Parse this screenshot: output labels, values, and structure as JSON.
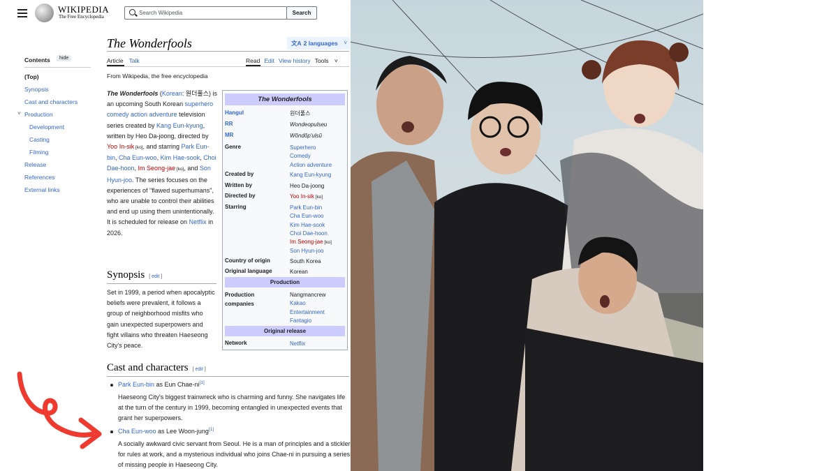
{
  "header": {
    "logo_wordmark": "WIKIPEDIA",
    "logo_tagline": "The Free Encyclopedia",
    "search_placeholder": "Search Wikipedia",
    "search_button": "Search"
  },
  "article": {
    "title": "The Wonderfools",
    "languages": "2 languages",
    "tabs_left": [
      "Article",
      "Talk"
    ],
    "tabs_right": [
      "Read",
      "Edit",
      "View history",
      "Tools"
    ],
    "from": "From Wikipedia, the free encyclopedia"
  },
  "toc": {
    "heading": "Contents",
    "hide": "hide",
    "items": [
      "(Top)",
      "Synopsis",
      "Cast and characters",
      "Production",
      "Development",
      "Casting",
      "Filming",
      "Release",
      "References",
      "External links"
    ]
  },
  "lead": {
    "t1": "The Wonderfools",
    "t2": " (",
    "t3": "Korean",
    "t4": ": 원더풀스) is an upcoming South Korean ",
    "t5": "superhero comedy action adventure",
    "t6": " television series created by ",
    "t7": "Kang Eun-kyung",
    "t8": ", written by Heo Da-joong, directed by ",
    "t9": "Yoo In-sik",
    "t10": " [ko]",
    "t11": ", and starring ",
    "t12": "Park Eun-bin",
    "t13": ", ",
    "t14": "Cha Eun-woo",
    "t15": ", ",
    "t16": "Kim Hae-sook",
    "t17": ", ",
    "t18": "Choi Dae-hoon",
    "t19": ", ",
    "t20": "Im Seong-jae",
    "t21": " [ko]",
    "t22": ", and ",
    "t23": "Son Hyun-joo",
    "t24": ". The series focuses on the experiences of \"flawed superhumans\", who are unable to control their abilities and end up using them unintentionally. It is scheduled for release on ",
    "t25": "Netflix",
    "t26": " in 2026."
  },
  "infobox": {
    "title": "The Wonderfools",
    "hangul_label": "Hangul",
    "hangul": "원더풀스",
    "rr_label": "RR",
    "rr": "Wondeopulseu",
    "mr_label": "MR",
    "mr": "Wŏndŏp'ulsŭ",
    "genre_label": "Genre",
    "genre": [
      "Superhero",
      "Comedy",
      "Action adventure"
    ],
    "created_label": "Created by",
    "created": "Kang Eun-kyung",
    "written_label": "Written by",
    "written": "Heo Da-joong",
    "directed_label": "Directed by",
    "directed": "Yoo In-sik",
    "directed_ko": " [ko]",
    "starring_label": "Starring",
    "starring": [
      "Park Eun-bin",
      "Cha Eun-woo",
      "Kim Hae-sook",
      "Choi Dae-hoon",
      "Im Seong-jae",
      "Son Hyun-joo"
    ],
    "starring_ko": " [ko]",
    "country_label": "Country of origin",
    "country": "South Korea",
    "language_label": "Original language",
    "language": "Korean",
    "production_band": "Production",
    "companies_label": "Production companies",
    "companies": [
      "Nangmancrew",
      "Kakao",
      "Entertainment",
      "Fantagio"
    ],
    "release_band": "Original release",
    "network_label": "Network",
    "network": "Netflix"
  },
  "synopsis": {
    "heading": "Synopsis",
    "edit": "edit",
    "text": "Set in 1999, a period when apocalyptic beliefs were prevalent, it follows a group of neighborhood misfits who gain unexpected superpowers and fight villains who threaten Haeseong City's peace."
  },
  "cast": {
    "heading": "Cast and characters",
    "edit": "edit",
    "items": [
      {
        "name": "Park Eun-bin",
        "role": " as Eun Chae-ni",
        "ref": "[1]",
        "desc": "Haeseong City's biggest trainwreck who is charming and funny. She navigates life at the turn of the century in 1999, becoming entangled in unexpected events that grant her superpowers."
      },
      {
        "name": "Cha Eun-woo",
        "role": " as Lee Woon-jung",
        "ref": "[1]",
        "desc": "A socially awkward civic servant from Seoul. He is a man of principles and a stickler for rules at work, and a mysterious individual who joins Chae-ni in pursuing a series of missing people in Haeseong City."
      }
    ]
  },
  "colors": {
    "link": "#3366cc",
    "redlink": "#ba0000",
    "infobox_band": "#ccccff",
    "arrow": "#ee3a2f"
  }
}
